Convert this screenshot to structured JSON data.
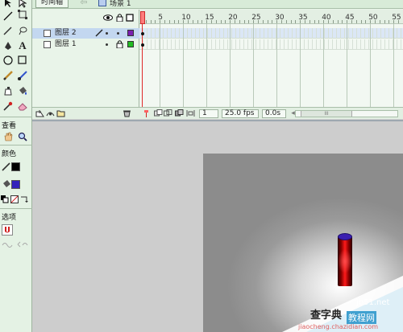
{
  "timeline": {
    "tab_label": "时间轴",
    "scene_label": "场景 1",
    "frame_numbers": [
      "5",
      "10",
      "15",
      "20",
      "25",
      "30",
      "35",
      "40",
      "45",
      "50",
      "55"
    ],
    "layers": [
      {
        "name": "图层 2",
        "selected": true,
        "color": "#7b1fb0"
      },
      {
        "name": "图层 1",
        "selected": false,
        "color": "#22bb22"
      }
    ],
    "current_frame": "1",
    "fps": "25.0 fps",
    "elapsed": "0.0s",
    "scroll_grip": "III"
  },
  "tools": {
    "view_label": "查看",
    "colors_label": "颜色",
    "options_label": "选项",
    "stroke_color": "#000000",
    "fill_color": "#3322bb",
    "icons": [
      "subselect-arrow-icon",
      "free-transform-icon",
      "lasso-icon",
      "line-icon",
      "pen-icon",
      "text-icon",
      "oval-icon",
      "rectangle-icon",
      "pencil-icon",
      "brush-icon",
      "ink-bottle-icon",
      "paint-bucket-icon",
      "eyedropper-icon",
      "eraser-icon",
      "hand-icon",
      "zoom-icon"
    ]
  },
  "watermark": {
    "line1": "查字典",
    "line2": "教程网",
    "site1": "jb51.net",
    "site2": "jiaocheng.chazidian.com"
  }
}
